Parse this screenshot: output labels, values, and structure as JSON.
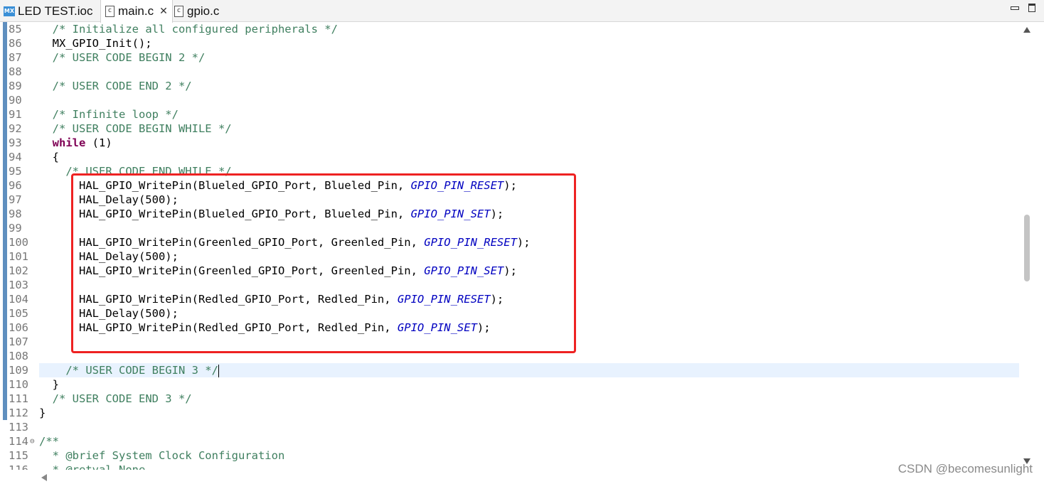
{
  "tabs": [
    {
      "icon": "mx-icon",
      "icon_text": "MX",
      "label": "LED TEST.ioc"
    },
    {
      "icon": "c-file-icon",
      "icon_text": "c",
      "label": "main.c",
      "active": true,
      "close": "✕"
    },
    {
      "icon": "c-file-icon",
      "icon_text": "c",
      "label": "gpio.c"
    }
  ],
  "editor": {
    "lines": [
      {
        "n": "85",
        "segs": [
          {
            "t": "  "
          },
          {
            "c": "cm",
            "t": "/* Initialize all configured peripherals */"
          }
        ]
      },
      {
        "n": "86",
        "segs": [
          {
            "t": "  MX_GPIO_Init();"
          }
        ]
      },
      {
        "n": "87",
        "segs": [
          {
            "t": "  "
          },
          {
            "c": "cm",
            "t": "/* USER CODE BEGIN 2 */"
          }
        ]
      },
      {
        "n": "88",
        "segs": []
      },
      {
        "n": "89",
        "segs": [
          {
            "t": "  "
          },
          {
            "c": "cm",
            "t": "/* USER CODE END 2 */"
          }
        ]
      },
      {
        "n": "90",
        "segs": []
      },
      {
        "n": "91",
        "segs": [
          {
            "t": "  "
          },
          {
            "c": "cm",
            "t": "/* Infinite loop */"
          }
        ]
      },
      {
        "n": "92",
        "segs": [
          {
            "t": "  "
          },
          {
            "c": "cm",
            "t": "/* USER CODE BEGIN WHILE */"
          }
        ]
      },
      {
        "n": "93",
        "segs": [
          {
            "t": "  "
          },
          {
            "c": "kw",
            "t": "while"
          },
          {
            "t": " (1)"
          }
        ]
      },
      {
        "n": "94",
        "segs": [
          {
            "t": "  {"
          }
        ]
      },
      {
        "n": "95",
        "segs": [
          {
            "t": "    "
          },
          {
            "c": "cm",
            "t": "/* USER CODE END WHILE */"
          }
        ]
      },
      {
        "n": "96",
        "segs": [
          {
            "t": "      HAL_GPIO_WritePin(Blueled_GPIO_Port, Blueled_Pin, "
          },
          {
            "c": "cn",
            "t": "GPIO_PIN_RESET"
          },
          {
            "t": ");"
          }
        ]
      },
      {
        "n": "97",
        "segs": [
          {
            "t": "      HAL_Delay(500);"
          }
        ]
      },
      {
        "n": "98",
        "segs": [
          {
            "t": "      HAL_GPIO_WritePin(Blueled_GPIO_Port, Blueled_Pin, "
          },
          {
            "c": "cn",
            "t": "GPIO_PIN_SET"
          },
          {
            "t": ");"
          }
        ]
      },
      {
        "n": "99",
        "segs": []
      },
      {
        "n": "100",
        "segs": [
          {
            "t": "      HAL_GPIO_WritePin(Greenled_GPIO_Port, Greenled_Pin, "
          },
          {
            "c": "cn",
            "t": "GPIO_PIN_RESET"
          },
          {
            "t": ");"
          }
        ]
      },
      {
        "n": "101",
        "segs": [
          {
            "t": "      HAL_Delay(500);"
          }
        ]
      },
      {
        "n": "102",
        "segs": [
          {
            "t": "      HAL_GPIO_WritePin(Greenled_GPIO_Port, Greenled_Pin, "
          },
          {
            "c": "cn",
            "t": "GPIO_PIN_SET"
          },
          {
            "t": ");"
          }
        ]
      },
      {
        "n": "103",
        "segs": []
      },
      {
        "n": "104",
        "segs": [
          {
            "t": "      HAL_GPIO_WritePin(Redled_GPIO_Port, Redled_Pin, "
          },
          {
            "c": "cn",
            "t": "GPIO_PIN_RESET"
          },
          {
            "t": ");"
          }
        ]
      },
      {
        "n": "105",
        "segs": [
          {
            "t": "      HAL_Delay(500);"
          }
        ]
      },
      {
        "n": "106",
        "segs": [
          {
            "t": "      HAL_GPIO_WritePin(Redled_GPIO_Port, Redled_Pin, "
          },
          {
            "c": "cn",
            "t": "GPIO_PIN_SET"
          },
          {
            "t": ");"
          }
        ]
      },
      {
        "n": "107",
        "segs": []
      },
      {
        "n": "108",
        "segs": []
      },
      {
        "n": "109",
        "segs": [
          {
            "t": "    "
          },
          {
            "c": "cm",
            "t": "/* USER CODE BEGIN 3 */"
          }
        ],
        "current": true
      },
      {
        "n": "110",
        "segs": [
          {
            "t": "  }"
          }
        ]
      },
      {
        "n": "111",
        "segs": [
          {
            "t": "  "
          },
          {
            "c": "cm",
            "t": "/* USER CODE END 3 */"
          }
        ]
      },
      {
        "n": "112",
        "segs": [
          {
            "t": "}"
          }
        ]
      },
      {
        "n": "113",
        "segs": []
      },
      {
        "n": "114",
        "segs": [
          {
            "c": "cm",
            "t": "/**"
          }
        ],
        "fold": "⊖"
      },
      {
        "n": "115",
        "segs": [
          {
            "c": "cm",
            "t": "  * @brief System Clock Configuration"
          }
        ]
      },
      {
        "n": "116",
        "segs": [
          {
            "c": "cm",
            "t": "  * @retval None"
          }
        ]
      }
    ]
  },
  "watermark": "CSDN @becomesunlight",
  "colors": {
    "highlight_box": "#ee2222",
    "comment": "#3f7f5f",
    "keyword": "#7f0055",
    "constant": "#0000c0"
  }
}
